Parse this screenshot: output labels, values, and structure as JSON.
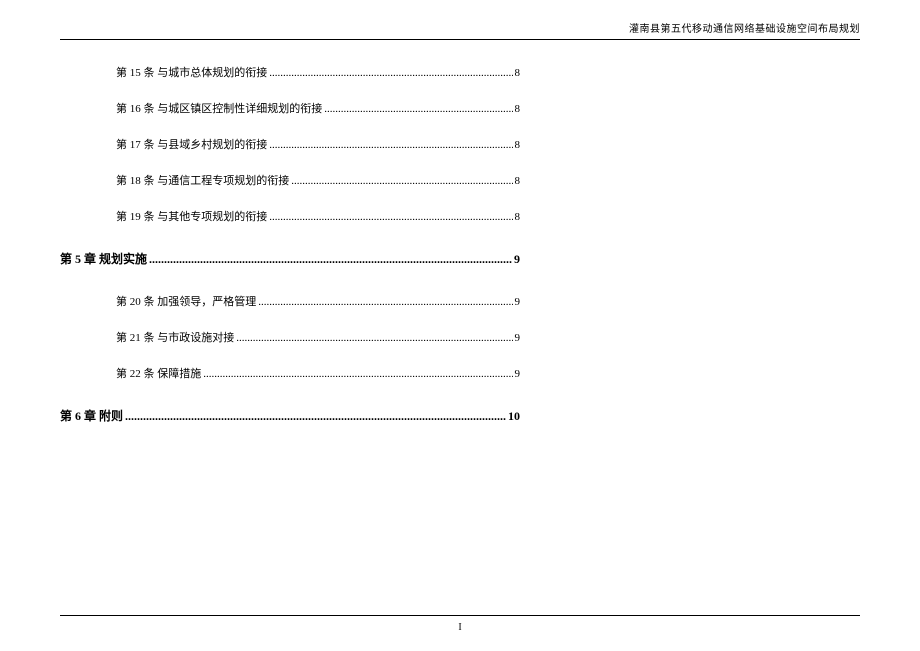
{
  "header": {
    "title": "灌南县第五代移动通信网络基础设施空间布局规划"
  },
  "toc": [
    {
      "level": 2,
      "label": "第 15 条 与城市总体规划的衔接",
      "page": "8"
    },
    {
      "level": 2,
      "label": "第 16 条 与城区镇区控制性详细规划的衔接",
      "page": "8"
    },
    {
      "level": 2,
      "label": "第 17 条 与县域乡村规划的衔接",
      "page": "8"
    },
    {
      "level": 2,
      "label": "第 18 条 与通信工程专项规划的衔接",
      "page": "8"
    },
    {
      "level": 2,
      "label": "第 19 条 与其他专项规划的衔接",
      "page": "8"
    },
    {
      "level": 1,
      "label": "第 5 章 规划实施",
      "page": "9"
    },
    {
      "level": 2,
      "label": "第 20 条 加强领导，严格管理",
      "page": "9"
    },
    {
      "level": 2,
      "label": "第 21 条 与市政设施对接",
      "page": "9"
    },
    {
      "level": 2,
      "label": "第 22 条 保障措施",
      "page": "9"
    },
    {
      "level": 1,
      "label": "第 6 章 附则",
      "page": "10"
    }
  ],
  "footer": {
    "pageNumber": "I"
  }
}
